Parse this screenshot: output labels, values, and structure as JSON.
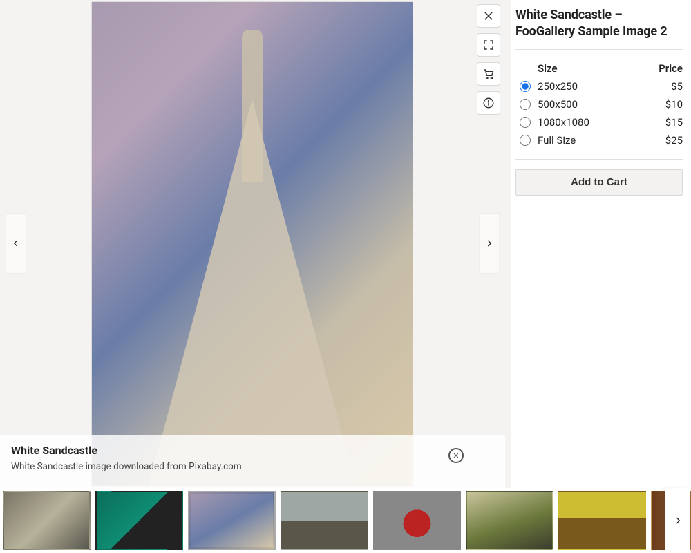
{
  "title": "White Sandcastle – FooGallery Sample Image 2",
  "caption": {
    "title": "White Sandcastle",
    "description": "White Sandcastle image downloaded from Pixabay.com"
  },
  "toolbar": {
    "close": "close",
    "fullscreen": "fullscreen",
    "cart": "cart",
    "info": "info"
  },
  "pricing": {
    "header_size": "Size",
    "header_price": "Price",
    "rows": [
      {
        "label": "250x250",
        "price": "$5",
        "selected": true
      },
      {
        "label": "500x500",
        "price": "$10",
        "selected": false
      },
      {
        "label": "1080x1080",
        "price": "$15",
        "selected": false
      },
      {
        "label": "Full Size",
        "price": "$25",
        "selected": false
      }
    ],
    "add_to_cart": "Add to Cart"
  },
  "thumbnails": [
    {
      "name": "abandoned-building",
      "active": false
    },
    {
      "name": "rusty-padlock",
      "active": false
    },
    {
      "name": "white-sandcastle",
      "active": true
    },
    {
      "name": "rocky-shore",
      "active": false
    },
    {
      "name": "fire-hydrant",
      "active": false
    },
    {
      "name": "green-hill",
      "active": false
    },
    {
      "name": "railway-tracks",
      "active": false
    },
    {
      "name": "library-shelf",
      "active": false
    }
  ]
}
